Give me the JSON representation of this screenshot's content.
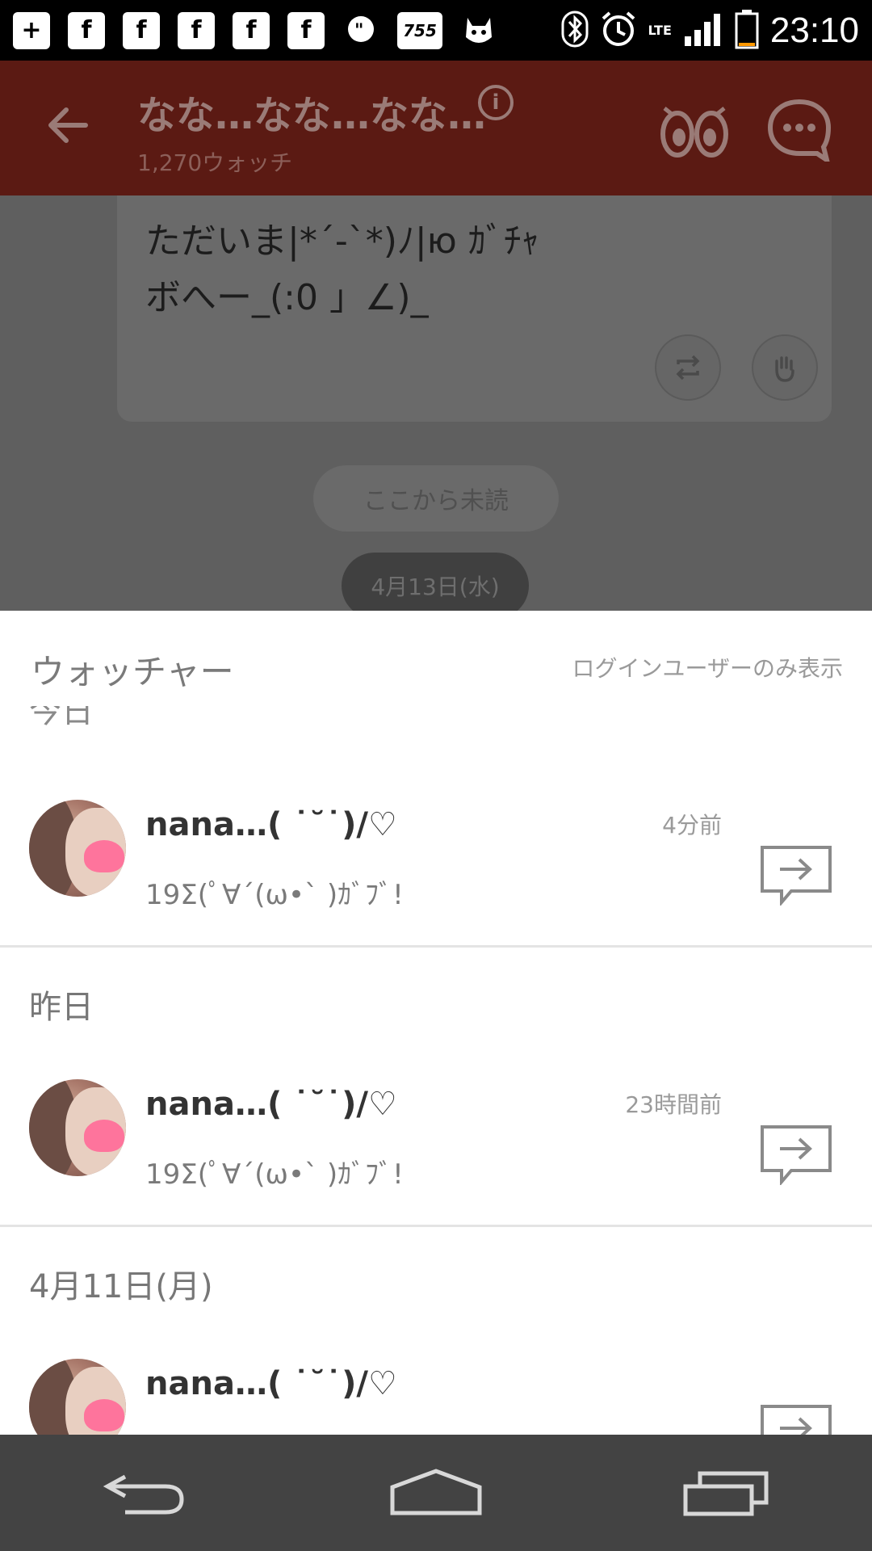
{
  "status_bar": {
    "time": "23:10",
    "left_icons": [
      "plus-icon",
      "facebook-icon",
      "facebook-icon",
      "facebook-icon",
      "facebook-icon",
      "facebook-icon",
      "quote-icon",
      "755-icon",
      "dog-icon"
    ],
    "right_icons": [
      "bluetooth-icon",
      "alarm-icon",
      "lte-icon",
      "signal-icon",
      "battery-icon"
    ],
    "lte_label": "LTE",
    "app_755_label": "755"
  },
  "app_bar": {
    "title": "なな…なな…なな…",
    "watch_count": "1,270ウォッチ",
    "color": "#5b1a13"
  },
  "chat": {
    "message_text": "ただいま|*´-`*)ﾉ|ю ｶﾞﾁｬ\nボへー_(:0 」∠)_",
    "unread_label": "ここから未読",
    "date_label": "4月13日(水)"
  },
  "sheet": {
    "title": "ウォッチャー",
    "note": "ログインユーザーのみ表示",
    "clipped_label": "今日",
    "sections": [
      {
        "label": "昨日",
        "items": []
      }
    ],
    "items": [
      {
        "name": "nana…( ˙˘˙)/♡",
        "time": "4分前",
        "message": "19Σ(ﾟ∀´(ω•` )ｶﾞﾌﾞ!"
      },
      {
        "name": "nana…( ˙˘˙)/♡",
        "time": "23時間前",
        "message": "19Σ(ﾟ∀´(ω•` )ｶﾞﾌﾞ!"
      },
      {
        "name": "nana…( ˙˘˙)/♡",
        "time": "",
        "message": ""
      }
    ],
    "section_labels": {
      "yesterday": "昨日",
      "april11": "4月11日(月)"
    }
  },
  "nav_bar": {
    "buttons": [
      "back-nav-icon",
      "home-nav-icon",
      "recents-nav-icon"
    ]
  }
}
